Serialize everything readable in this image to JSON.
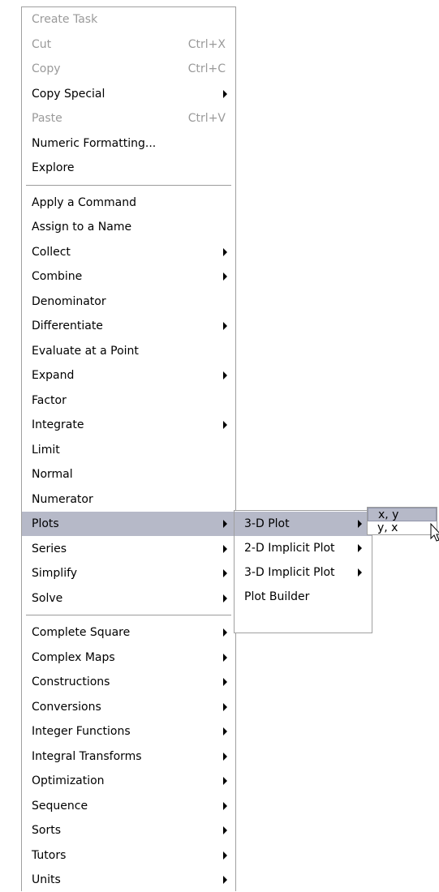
{
  "main_menu": {
    "items": [
      {
        "label": "Create Task",
        "shortcut": "",
        "disabled": true,
        "submenu": false
      },
      {
        "label": "Cut",
        "shortcut": "Ctrl+X",
        "disabled": true,
        "submenu": false
      },
      {
        "label": "Copy",
        "shortcut": "Ctrl+C",
        "disabled": true,
        "submenu": false
      },
      {
        "label": "Copy Special",
        "shortcut": "",
        "disabled": false,
        "submenu": true
      },
      {
        "label": "Paste",
        "shortcut": "Ctrl+V",
        "disabled": true,
        "submenu": false
      },
      {
        "label": "Numeric Formatting...",
        "shortcut": "",
        "disabled": false,
        "submenu": false
      },
      {
        "label": "Explore",
        "shortcut": "",
        "disabled": false,
        "submenu": false
      },
      {
        "label": "Apply a Command",
        "shortcut": "",
        "disabled": false,
        "submenu": false
      },
      {
        "label": "Assign to a Name",
        "shortcut": "",
        "disabled": false,
        "submenu": false
      },
      {
        "label": "Collect",
        "shortcut": "",
        "disabled": false,
        "submenu": true
      },
      {
        "label": "Combine",
        "shortcut": "",
        "disabled": false,
        "submenu": true
      },
      {
        "label": "Denominator",
        "shortcut": "",
        "disabled": false,
        "submenu": false
      },
      {
        "label": "Differentiate",
        "shortcut": "",
        "disabled": false,
        "submenu": true
      },
      {
        "label": "Evaluate at a Point",
        "shortcut": "",
        "disabled": false,
        "submenu": false
      },
      {
        "label": "Expand",
        "shortcut": "",
        "disabled": false,
        "submenu": true
      },
      {
        "label": "Factor",
        "shortcut": "",
        "disabled": false,
        "submenu": false
      },
      {
        "label": "Integrate",
        "shortcut": "",
        "disabled": false,
        "submenu": true
      },
      {
        "label": "Limit",
        "shortcut": "",
        "disabled": false,
        "submenu": false
      },
      {
        "label": "Normal",
        "shortcut": "",
        "disabled": false,
        "submenu": false
      },
      {
        "label": "Numerator",
        "shortcut": "",
        "disabled": false,
        "submenu": false
      },
      {
        "label": "Plots",
        "shortcut": "",
        "disabled": false,
        "submenu": true,
        "highlighted": true
      },
      {
        "label": "Series",
        "shortcut": "",
        "disabled": false,
        "submenu": true
      },
      {
        "label": "Simplify",
        "shortcut": "",
        "disabled": false,
        "submenu": true
      },
      {
        "label": "Solve",
        "shortcut": "",
        "disabled": false,
        "submenu": true
      },
      {
        "label": "Complete Square",
        "shortcut": "",
        "disabled": false,
        "submenu": true
      },
      {
        "label": "Complex Maps",
        "shortcut": "",
        "disabled": false,
        "submenu": true
      },
      {
        "label": "Constructions",
        "shortcut": "",
        "disabled": false,
        "submenu": true
      },
      {
        "label": "Conversions",
        "shortcut": "",
        "disabled": false,
        "submenu": true
      },
      {
        "label": "Integer Functions",
        "shortcut": "",
        "disabled": false,
        "submenu": true
      },
      {
        "label": "Integral Transforms",
        "shortcut": "",
        "disabled": false,
        "submenu": true
      },
      {
        "label": "Optimization",
        "shortcut": "",
        "disabled": false,
        "submenu": true
      },
      {
        "label": "Sequence",
        "shortcut": "",
        "disabled": false,
        "submenu": true
      },
      {
        "label": "Sorts",
        "shortcut": "",
        "disabled": false,
        "submenu": true
      },
      {
        "label": "Tutors",
        "shortcut": "",
        "disabled": false,
        "submenu": true
      },
      {
        "label": "Units",
        "shortcut": "",
        "disabled": false,
        "submenu": true
      }
    ]
  },
  "plots_submenu": {
    "items": [
      {
        "label": "3-D Plot",
        "submenu": true,
        "highlighted": true
      },
      {
        "label": "2-D Implicit Plot",
        "submenu": true
      },
      {
        "label": "3-D Implicit Plot",
        "submenu": true
      },
      {
        "label": "Plot Builder",
        "submenu": false
      }
    ]
  },
  "plot3d_submenu": {
    "items": [
      {
        "label": "x, y",
        "highlighted": true
      },
      {
        "label": "y, x"
      }
    ]
  },
  "colors": {
    "highlight": "#b6b9c8",
    "disabled_text": "#9a9a9a",
    "border": "#a0a0a0"
  }
}
